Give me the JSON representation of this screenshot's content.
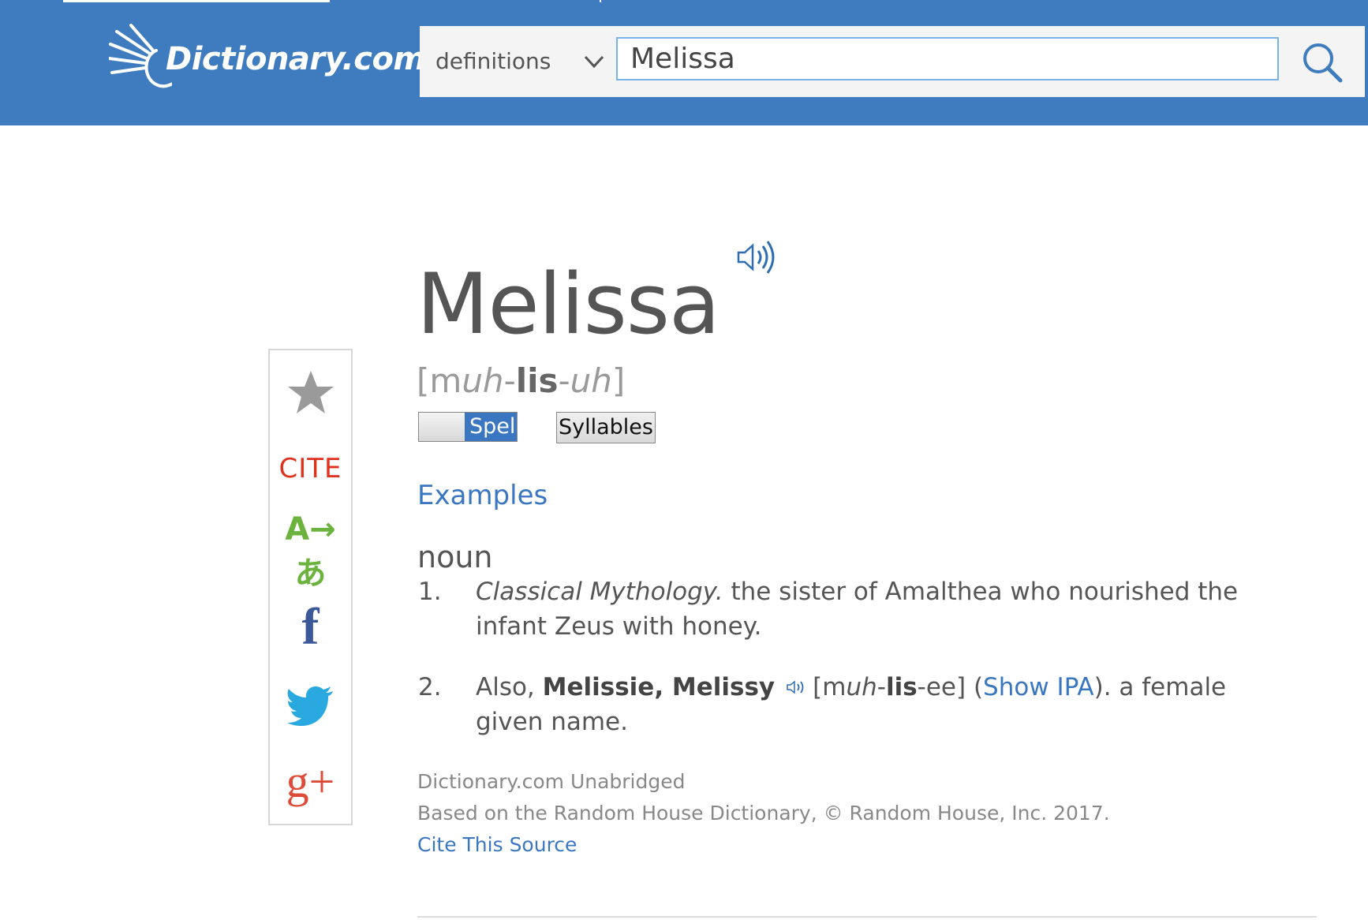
{
  "header": {
    "logo_text": "Dictionary.com",
    "search_mode": "definitions",
    "search_value": "Melissa"
  },
  "entry": {
    "headword": "Melissa",
    "pronunciation": {
      "open": "[m",
      "p1": "uh",
      "sep1": "-",
      "p2": "lis",
      "sep2": "-",
      "p3": "uh",
      "close": "]"
    },
    "spell_toggle_label": "Spell",
    "syllables_label": "Syllables",
    "examples_label": "Examples",
    "part_of_speech": "noun",
    "definitions": [
      {
        "number": "1.",
        "label": "Classical Mythology.",
        "text": " the sister of Amalthea who nourished the infant Zeus with honey."
      },
      {
        "number": "2.",
        "prefix": "Also, ",
        "variants": "Melissie, Melissy",
        "pron_open": "[m",
        "pron_p1": "uh",
        "pron_sep1": "-",
        "pron_p2": "lis",
        "pron_rest": "-ee]",
        "paren_open": " (",
        "show_ipa": "Show IPA",
        "suffix": "). a female given name."
      }
    ],
    "source_name": "Dictionary.com Unabridged",
    "source_credit": "Based on the Random House Dictionary, © Random House, Inc. 2017.",
    "cite_label": "Cite This Source"
  },
  "sidebar": {
    "star_icon": "star-icon",
    "cite_label": "CITE",
    "translate_label": "A→あ",
    "facebook_label": "f",
    "twitter_icon": "twitter-icon",
    "googleplus_label": "g+"
  },
  "colors": {
    "header_bg": "#3f7cbf",
    "link": "#3a77c0",
    "cite_red": "#e0301e",
    "translate_green": "#6cb33e",
    "facebook_blue": "#3b5998",
    "googleplus_red": "#dd4b39"
  }
}
